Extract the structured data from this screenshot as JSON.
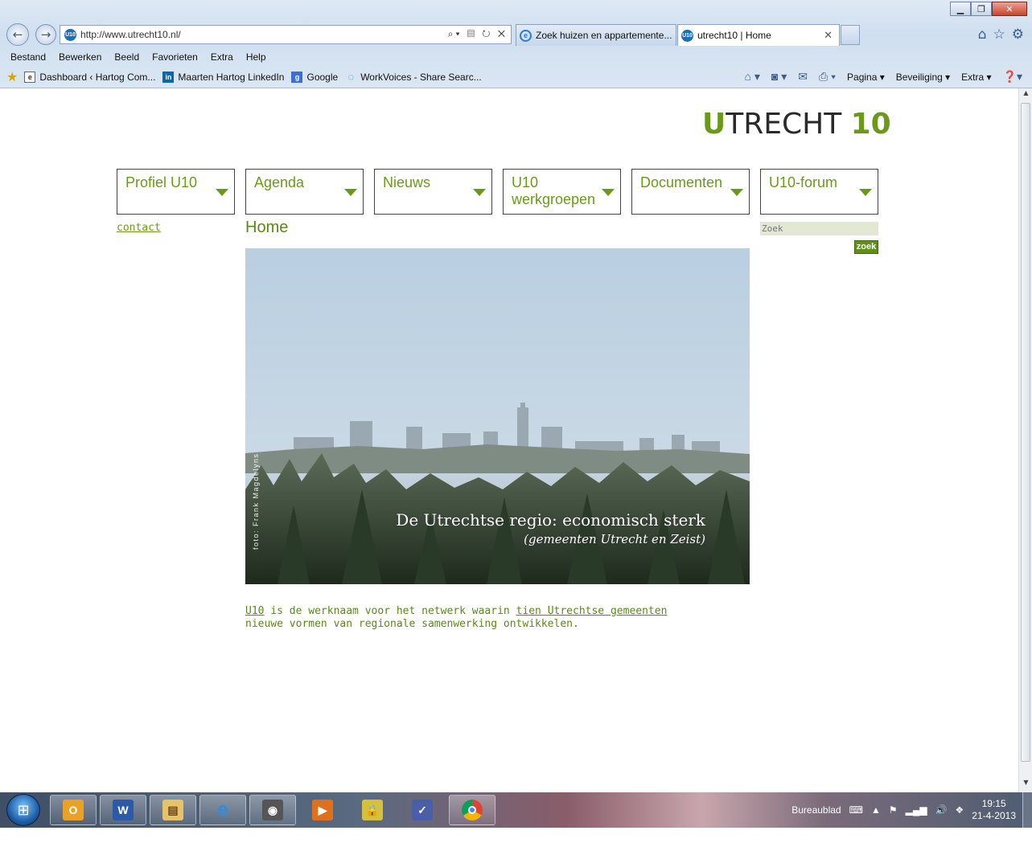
{
  "browser": {
    "window_title": "",
    "address_url": "http://www.utrecht10.nl/",
    "tabs": [
      {
        "label": "Zoek huizen en appartemente...",
        "active": false
      },
      {
        "label": "utrecht10 | Home",
        "active": true
      }
    ],
    "menu": [
      "Bestand",
      "Bewerken",
      "Beeld",
      "Favorieten",
      "Extra",
      "Help"
    ],
    "favorites": [
      {
        "label": "Dashboard ‹ Hartog Com...",
        "icon": "page-icon"
      },
      {
        "label": "Maarten Hartog  LinkedIn",
        "icon": "linkedin-icon"
      },
      {
        "label": "Google",
        "icon": "google-icon"
      },
      {
        "label": "WorkVoices - Share  Searc...",
        "icon": "workvoices-icon"
      }
    ],
    "command_bar": {
      "page": "Pagina",
      "security": "Beveiliging",
      "tools": "Extra"
    }
  },
  "site": {
    "logo": {
      "u": "U",
      "rest": "TRECHT ",
      "num": "10"
    },
    "nav": [
      "Profiel U10",
      "Agenda",
      "Nieuws",
      "U10 werkgroepen",
      "Documenten",
      "U10-forum"
    ],
    "contact_link": "contact",
    "page_title": "Home",
    "search": {
      "placeholder": "Zoek",
      "button": "zoek"
    },
    "hero": {
      "caption_main": "De Utrechtse regio: economisch sterk",
      "caption_sub": "(gemeenten Utrecht en Zeist)",
      "credit": "foto: Frank Magdelyns"
    },
    "intro": {
      "link1": "U10",
      "text1": " is de werknaam voor het netwerk waarin ",
      "link2": "tien Utrechtse gemeenten",
      "text2": "nieuwe vormen van regionale samenwerking ontwikkelen."
    }
  },
  "taskbar": {
    "desktop_label": "Bureaublad",
    "time": "19:15",
    "date": "21-4-2013"
  },
  "colors": {
    "brand_green": "#6b9a1a",
    "search_bg": "#e2e8d3"
  }
}
